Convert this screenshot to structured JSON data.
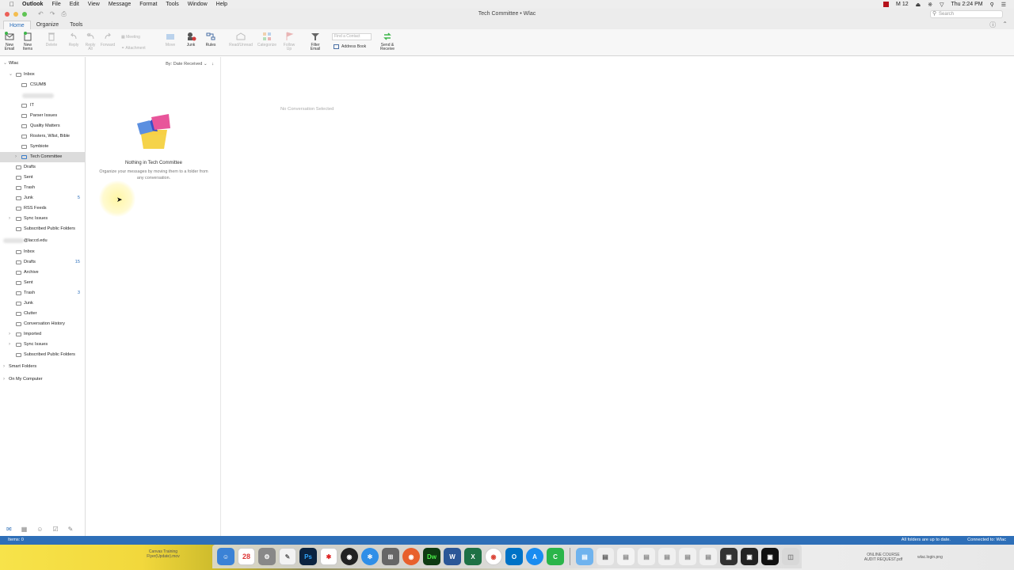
{
  "menubar": {
    "app": "Outlook",
    "items": [
      "File",
      "Edit",
      "View",
      "Message",
      "Format",
      "Tools",
      "Window",
      "Help"
    ],
    "badge_count": "12",
    "clock": "Thu 2:24 PM"
  },
  "window": {
    "title": "Tech Committee • Wlac",
    "search_placeholder": "Search"
  },
  "ribbon_tabs": [
    "Home",
    "Organize",
    "Tools"
  ],
  "ribbon": {
    "new_email": [
      "New",
      "Email"
    ],
    "new_items": [
      "New",
      "Items"
    ],
    "delete": "Delete",
    "reply": "Reply",
    "reply_all": [
      "Reply",
      "All"
    ],
    "forward": "Forward",
    "meeting": "Meeting",
    "attachment": "Attachment",
    "move": "Move",
    "junk": "Junk",
    "rules": "Rules",
    "read_unread": "Read/Unread",
    "categorize": "Categorize",
    "follow_up": [
      "Follow",
      "Up"
    ],
    "filter_email": [
      "Filter",
      "Email"
    ],
    "find_contact_placeholder": "Find a Contact",
    "address_book": "Address Book",
    "send_receive": [
      "Send &",
      "Receive"
    ]
  },
  "sidebar": {
    "account1": "Wlac",
    "folders1": [
      {
        "label": "Inbox",
        "count": ""
      },
      {
        "label": "CSUMB",
        "count": ""
      },
      {
        "label": "IT",
        "count": ""
      },
      {
        "label": "Parser Issues",
        "count": ""
      },
      {
        "label": "Quality Matters",
        "count": ""
      },
      {
        "label": "Rosters, Wlist, Bible",
        "count": ""
      },
      {
        "label": "Symbiote",
        "count": ""
      },
      {
        "label": "Tech Committee",
        "count": ""
      },
      {
        "label": "Drafts",
        "count": ""
      },
      {
        "label": "Sent",
        "count": ""
      },
      {
        "label": "Trash",
        "count": ""
      },
      {
        "label": "Junk",
        "count": "5"
      },
      {
        "label": "RSS Feeds",
        "count": ""
      },
      {
        "label": "Sync Issues",
        "count": ""
      },
      {
        "label": "Subscribed Public Folders",
        "count": ""
      }
    ],
    "account2": "@laccd.edu",
    "folders2": [
      {
        "label": "Inbox",
        "count": ""
      },
      {
        "label": "Drafts",
        "count": "15"
      },
      {
        "label": "Archive",
        "count": ""
      },
      {
        "label": "Sent",
        "count": ""
      },
      {
        "label": "Trash",
        "count": "3"
      },
      {
        "label": "Junk",
        "count": ""
      },
      {
        "label": "Clutter",
        "count": ""
      },
      {
        "label": "Conversation History",
        "count": ""
      },
      {
        "label": "Imported",
        "count": ""
      },
      {
        "label": "Sync Issues",
        "count": ""
      },
      {
        "label": "Subscribed Public Folders",
        "count": ""
      }
    ],
    "smart_folders": "Smart Folders",
    "on_my_computer": "On My Computer"
  },
  "message_list": {
    "sort_label": "By: Date Received",
    "empty_title": "Nothing in Tech Committee",
    "empty_desc": "Organize your messages by moving them to a folder from any conversation."
  },
  "reading_pane": {
    "empty": "No Conversation Selected"
  },
  "status": {
    "items": "Items: 0",
    "sync": "All folders are up to date.",
    "connected": "Connected to: Wlac"
  },
  "desktop": {
    "label1": [
      "Canvas Training",
      "Flyer(Update).mov"
    ],
    "label2": [
      "ONLINE COURSE",
      "AUDIT REQUEST.pdf"
    ],
    "label3": "wlac.login.png"
  },
  "dock": {
    "calendar_day": "28",
    "ps": "Ps",
    "dw": "Dw"
  },
  "colors": {
    "accent": "#2e6fb8",
    "selected_row": "#dcdcdc"
  }
}
